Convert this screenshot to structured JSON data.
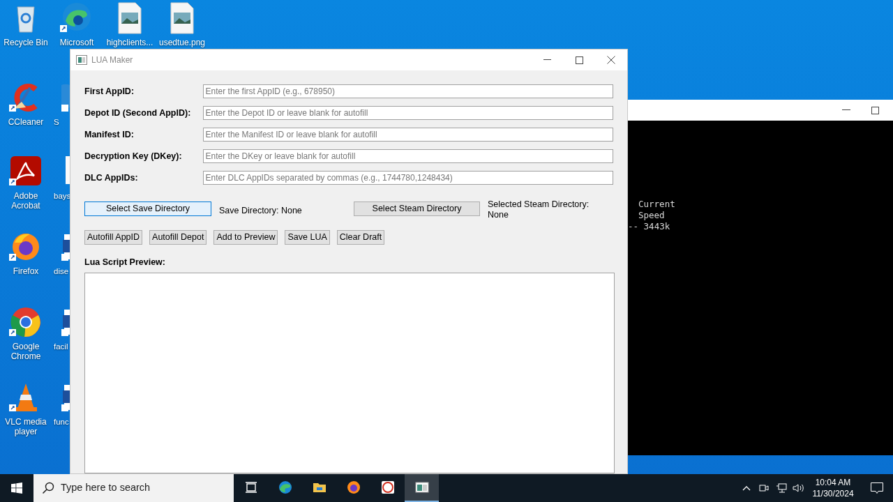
{
  "desktop_icons": [
    {
      "label": "Recycle Bin",
      "kind": "recycle"
    },
    {
      "label": "Microsoft",
      "kind": "edge"
    },
    {
      "label": "highclients...",
      "kind": "image"
    },
    {
      "label": "usedtue.png",
      "kind": "image"
    },
    {
      "label": "CCleaner",
      "kind": "ccleaner"
    },
    {
      "label": "S",
      "kind": "blueball"
    },
    {
      "label": "Adobe Acrobat",
      "kind": "acrobat"
    },
    {
      "label": "bays",
      "kind": "doc"
    },
    {
      "label": "Firefox",
      "kind": "firefox"
    },
    {
      "label": "dise",
      "kind": "word"
    },
    {
      "label": "Google Chrome",
      "kind": "chrome"
    },
    {
      "label": "facil",
      "kind": "word"
    },
    {
      "label": "VLC media player",
      "kind": "vlc"
    },
    {
      "label": "func",
      "kind": "word"
    }
  ],
  "console_window": {
    "lines": [
      "Current",
      "Speed",
      "-- 3443k"
    ]
  },
  "window": {
    "title": "LUA Maker",
    "fields": [
      {
        "label": "First AppID:",
        "placeholder": "Enter the first AppID (e.g., 678950)"
      },
      {
        "label": "Depot ID (Second AppID):",
        "placeholder": "Enter the Depot ID or leave blank for autofill"
      },
      {
        "label": "Manifest ID:",
        "placeholder": "Enter the Manifest ID or leave blank for autofill"
      },
      {
        "label": "Decryption Key (DKey):",
        "placeholder": "Enter the DKey or leave blank for autofill"
      },
      {
        "label": "DLC AppIDs:",
        "placeholder": "Enter DLC AppIDs separated by commas (e.g., 1744780,1248434)"
      }
    ],
    "save_directory_button": {
      "label": "Select Save Directory",
      "focused": true
    },
    "save_directory_text": "Save Directory: None",
    "steam_directory_button": {
      "label": "Select Steam Directory",
      "focused": false
    },
    "steam_directory_text": [
      "Selected Steam Directory:",
      "None"
    ],
    "action_buttons": [
      "Autofill AppID",
      "Autofill Depot",
      "Add to Preview",
      "Save LUA",
      "Clear Draft"
    ],
    "preview_label": "Lua Script Preview:"
  },
  "taskbar": {
    "search_placeholder": "Type here to search",
    "apps": [
      {
        "kind": "taskview",
        "selected": false
      },
      {
        "kind": "edge",
        "selected": false
      },
      {
        "kind": "explorer",
        "selected": false
      },
      {
        "kind": "firefox",
        "selected": false
      },
      {
        "kind": "codeapp",
        "selected": false
      },
      {
        "kind": "window",
        "selected": true
      }
    ],
    "time": "10:04 AM",
    "date": "11/30/2024"
  }
}
